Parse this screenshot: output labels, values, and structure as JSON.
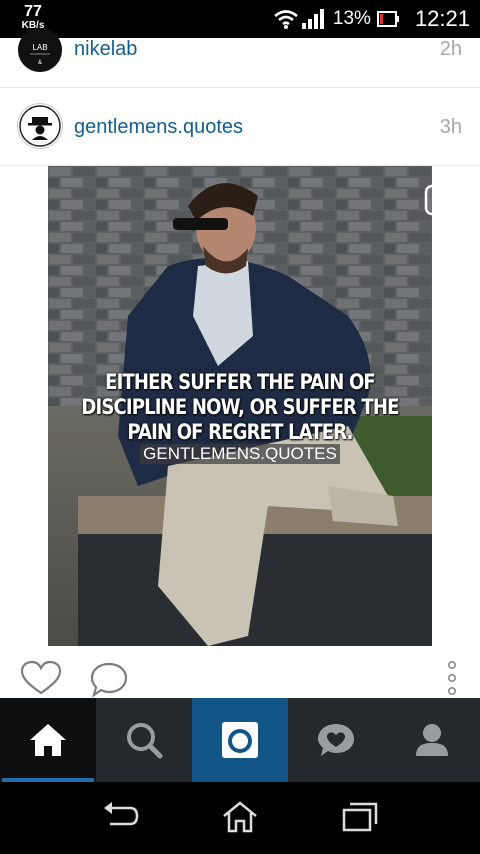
{
  "status_bar": {
    "net_speed": "77",
    "net_speed_unit": "KB/s",
    "battery_percent": "13%",
    "time": "12:21",
    "icons": [
      "wifi-icon",
      "signal-icon",
      "battery-icon"
    ]
  },
  "feed": [
    {
      "username": "nikelab",
      "time_ago": "2h",
      "avatar_text": "LAB"
    },
    {
      "username": "gentlemens.quotes",
      "time_ago": "3h"
    }
  ],
  "post": {
    "quote": "EITHER SUFFER THE PAIN OF DISCIPLINE NOW, OR SUFFER THE PAIN OF REGRET LATER.",
    "watermark": "GENTLEMENS.QUOTES",
    "media_type_icon": "video-camera-icon"
  },
  "actions": [
    "heart-icon",
    "comment-bubble-icon",
    "more-vertical-icon"
  ],
  "tab_bar": {
    "tabs": [
      "home-icon",
      "search-icon",
      "camera-icon",
      "activity-heart-icon",
      "profile-icon"
    ],
    "active": "home-icon"
  },
  "colors": {
    "username": "#135f8f",
    "tab_bar": "#24292e",
    "camera_tab": "#125688",
    "active_underline": "#1f6fae"
  }
}
